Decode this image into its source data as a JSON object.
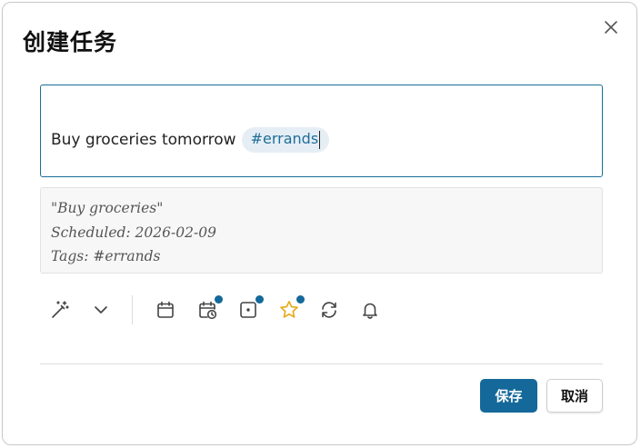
{
  "dialog": {
    "title": "创建任务",
    "close_icon": "close-icon"
  },
  "input": {
    "text": "Buy groceries tomorrow",
    "tag": "#errands"
  },
  "preview": {
    "lines": [
      "\"Buy groceries\"",
      "Scheduled: 2026-02-09",
      "Tags: #errands"
    ]
  },
  "toolbar": {
    "icons": [
      {
        "name": "magic-wand-icon",
        "indicator": false
      },
      {
        "name": "chevron-down-icon",
        "indicator": false
      },
      {
        "name": "calendar-icon",
        "indicator": false
      },
      {
        "name": "scheduled-calendar-icon",
        "indicator": true
      },
      {
        "name": "due-box-icon",
        "indicator": true
      },
      {
        "name": "star-icon",
        "indicator": true
      },
      {
        "name": "recurrence-icon",
        "indicator": false
      },
      {
        "name": "bell-icon",
        "indicator": false
      }
    ],
    "accent": "#14699a",
    "star_color": "#e6a817"
  },
  "footer": {
    "save_label": "保存",
    "cancel_label": "取消"
  }
}
